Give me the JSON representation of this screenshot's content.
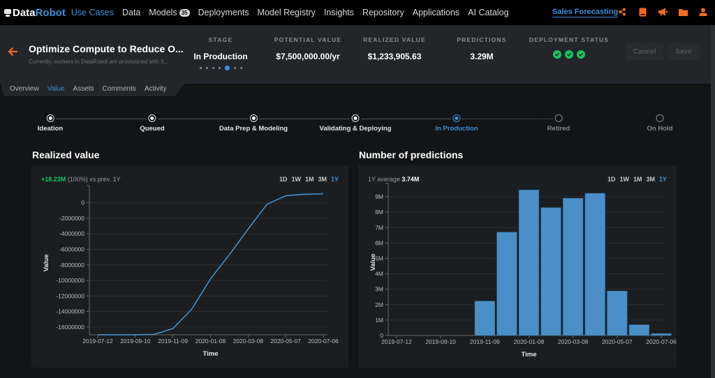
{
  "nav": {
    "logo_left": "Data",
    "logo_right": "Robot",
    "items": [
      {
        "label": "Use Cases",
        "active": true
      },
      {
        "label": "Data"
      },
      {
        "label": "Models",
        "badge": "35"
      },
      {
        "label": "Deployments"
      },
      {
        "label": "Model Registry"
      },
      {
        "label": "Insights"
      },
      {
        "label": "Repository"
      },
      {
        "label": "Applications"
      },
      {
        "label": "AI Catalog"
      }
    ],
    "project": "Sales Forecasting",
    "icons": [
      "share-icon",
      "book-icon",
      "megaphone-icon",
      "folder-icon",
      "user-icon"
    ],
    "accent": "#f26a21"
  },
  "header": {
    "title": "Optimize Compute to Reduce O...",
    "subtitle": "Currently, workers in DataRobot are provisioned with 3...",
    "metrics": {
      "stage": {
        "label": "STAGE",
        "value": "In Production",
        "step": 5,
        "steps": 7
      },
      "potential": {
        "label": "POTENTIAL VALUE",
        "value": "$7,500,000.00/yr"
      },
      "realized": {
        "label": "REALIZED VALUE",
        "value": "$1,233,905.63"
      },
      "predictions": {
        "label": "PREDICTIONS",
        "value": "3.29M"
      },
      "deployment": {
        "label": "DEPLOYMENT STATUS",
        "status": [
          "ok",
          "ok",
          "ok"
        ]
      }
    },
    "cancel_label": "Cancel",
    "save_label": "Save"
  },
  "tabs": [
    {
      "label": "Overview"
    },
    {
      "label": "Value",
      "active": true
    },
    {
      "label": "Assets"
    },
    {
      "label": "Comments"
    },
    {
      "label": "Activity"
    }
  ],
  "stages": [
    {
      "label": "Ideation",
      "state": "done"
    },
    {
      "label": "Queued",
      "state": "done"
    },
    {
      "label": "Data Prep & Modeling",
      "state": "done"
    },
    {
      "label": "Validating & Deploying",
      "state": "done"
    },
    {
      "label": "In Production",
      "state": "current"
    },
    {
      "label": "Retired",
      "state": "future"
    },
    {
      "label": "On Hold",
      "state": "future"
    }
  ],
  "realized_panel": {
    "title": "Realized value",
    "change": "+18.23M",
    "change_rest": " (100%) vs prev. 1Y",
    "ranges": [
      "1D",
      "1W",
      "1M",
      "3M",
      "1Y"
    ],
    "active_range": "1Y"
  },
  "predictions_panel": {
    "title": "Number of predictions",
    "avg_label": "1Y average ",
    "avg_value": "3.74M",
    "ranges": [
      "1D",
      "1W",
      "1M",
      "3M",
      "1Y"
    ],
    "active_range": "1Y"
  },
  "chart_data": [
    {
      "type": "line",
      "title": "Realized value",
      "xlabel": "Time",
      "ylabel": "Value",
      "x_ticks": [
        "2019-07-12",
        "2019-09-10",
        "2019-11-09",
        "2020-01-08",
        "2020-03-08",
        "2020-05-07",
        "2020-07-06"
      ],
      "y_ticks": [
        0,
        -2000000,
        -4000000,
        -6000000,
        -8000000,
        -10000000,
        -12000000,
        -14000000,
        -16000000
      ],
      "ylim": [
        -17000000,
        1500000
      ],
      "grid": true,
      "color": "#4a9bd8",
      "series": [
        {
          "name": "Realized value",
          "x": [
            0,
            0.5,
            1,
            1.5,
            2,
            2.5,
            3,
            3.5,
            4,
            4.5,
            5,
            5.5,
            6
          ],
          "values": [
            -17000000,
            -17000000,
            -17000000,
            -16950000,
            -16200000,
            -13700000,
            -9800000,
            -6700000,
            -3400000,
            -200000,
            900000,
            1100000,
            1150000
          ]
        }
      ]
    },
    {
      "type": "bar",
      "title": "Number of predictions",
      "xlabel": "Time",
      "ylabel": "Value",
      "x_ticks": [
        "2019-07-12",
        "2019-09-10",
        "2019-11-09",
        "2020-01-08",
        "2020-03-08",
        "2020-05-07",
        "2020-07-06"
      ],
      "y_ticks": [
        "0",
        "1M",
        "2M",
        "3M",
        "4M",
        "5M",
        "6M",
        "7M",
        "8M",
        "9M"
      ],
      "ylim": [
        0,
        9500000
      ],
      "grid": true,
      "color": "#4a8fc7",
      "series": [
        {
          "name": "Predictions",
          "x": [
            2,
            2.5,
            3,
            3.5,
            4,
            4.5,
            5,
            5.5,
            6
          ],
          "values": [
            2230000,
            6700000,
            9440000,
            8290000,
            8900000,
            9220000,
            2880000,
            690000,
            120000
          ]
        }
      ]
    }
  ]
}
